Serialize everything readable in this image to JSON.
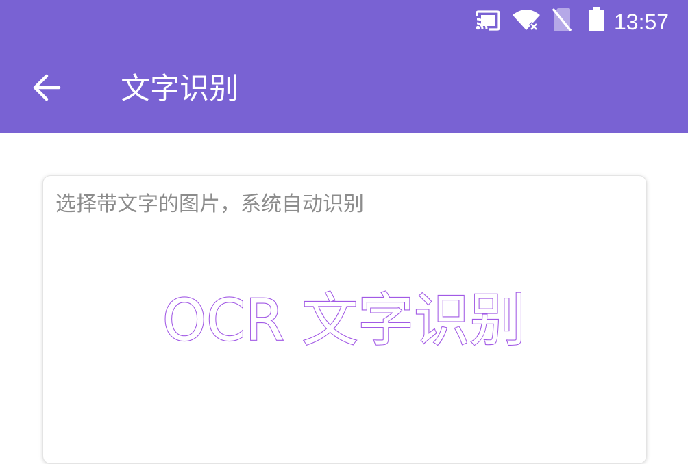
{
  "status_bar": {
    "time": "13:57",
    "icons": [
      "cast-icon",
      "wifi-off-icon",
      "no-sim-icon",
      "battery-icon"
    ]
  },
  "app_bar": {
    "title": "文字识别",
    "back_icon": "arrow-left-icon",
    "background_color": "#7962d3"
  },
  "card": {
    "hint": "选择带文字的图片，系统自动识别",
    "banner_text": "OCR 文字识别",
    "banner_outline_color": "#a25ae5"
  }
}
